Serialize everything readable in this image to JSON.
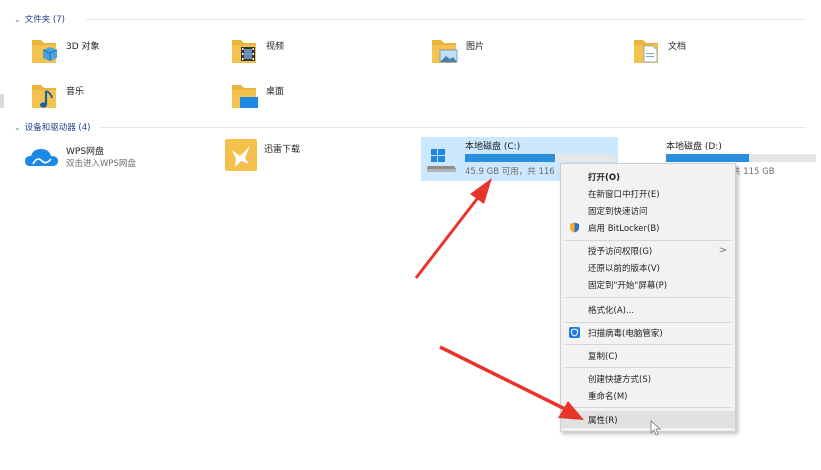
{
  "folders_group": {
    "title": "文件夹 (7)"
  },
  "folders": [
    {
      "label": "3D 对象"
    },
    {
      "label": "视频"
    },
    {
      "label": "图片"
    },
    {
      "label": "文档"
    },
    {
      "label": "音乐"
    },
    {
      "label": "桌面"
    }
  ],
  "devices_group": {
    "title": "设备和驱动器 (4)"
  },
  "devices": {
    "wps": {
      "label": "WPS网盘",
      "sub": "双击进入WPS网盘"
    },
    "xunlei": {
      "label": "迅雷下载"
    },
    "drive_c": {
      "label": "本地磁盘 (C:)",
      "capacity": "45.9 GB 可用，共 116",
      "used_fraction": 0.6
    },
    "drive_d": {
      "label": "本地磁盘 (D:)",
      "capacity": "共 115 GB",
      "used_fraction": 0.55
    }
  },
  "context_menu": {
    "items": [
      {
        "label": "打开(O)"
      },
      {
        "label": "在新窗口中打开(E)"
      },
      {
        "label": "固定到快速访问"
      },
      {
        "label": "启用 BitLocker(B)",
        "icon": "shield-icon"
      },
      {
        "label": "授予访问权限(G)",
        "submenu_glyph": ">"
      },
      {
        "label": "还原以前的版本(V)"
      },
      {
        "label": "固定到\"开始\"屏幕(P)"
      },
      {
        "label": "格式化(A)..."
      },
      {
        "label": "扫描病毒(电脑管家)",
        "icon": "tencent-pc-manager-icon"
      },
      {
        "label": "复制(C)"
      },
      {
        "label": "创建快捷方式(S)"
      },
      {
        "label": "重命名(M)"
      },
      {
        "label": "属性(R)"
      }
    ]
  },
  "colors": {
    "selection": "#cce8ff",
    "drive_bar": "#2a8fdd",
    "annotation_arrow": "#e8352b",
    "folder": "#f4c24e"
  }
}
